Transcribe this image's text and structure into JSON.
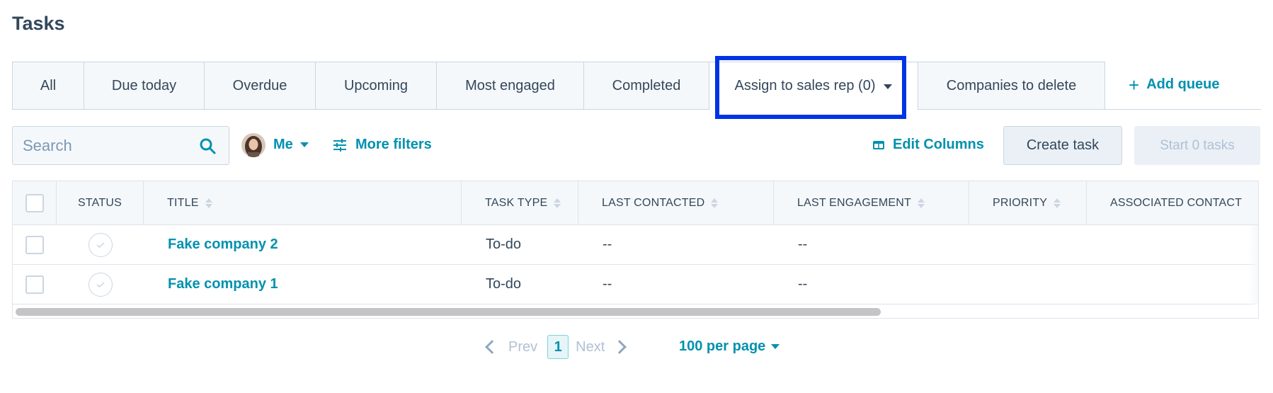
{
  "page_title": "Tasks",
  "tabs": [
    {
      "label": "All"
    },
    {
      "label": "Due today"
    },
    {
      "label": "Overdue"
    },
    {
      "label": "Upcoming"
    },
    {
      "label": "Most engaged"
    },
    {
      "label": "Completed"
    },
    {
      "label": "Assign to sales rep (0)",
      "active": true
    },
    {
      "label": "Companies to delete"
    }
  ],
  "add_queue_label": "Add queue",
  "search": {
    "placeholder": "Search",
    "value": ""
  },
  "owner_filter_label": "Me",
  "more_filters_label": "More filters",
  "edit_columns_label": "Edit Columns",
  "create_task_label": "Create task",
  "start_tasks_label": "Start 0 tasks",
  "table": {
    "headers": [
      "STATUS",
      "TITLE",
      "TASK TYPE",
      "LAST CONTACTED",
      "LAST ENGAGEMENT",
      "PRIORITY",
      "ASSOCIATED CONTACT"
    ],
    "rows": [
      {
        "title": "Fake company 2",
        "task_type": "To-do",
        "last_contacted": "--",
        "last_engagement": "--"
      },
      {
        "title": "Fake company 1",
        "task_type": "To-do",
        "last_contacted": "--",
        "last_engagement": "--"
      }
    ]
  },
  "pagination": {
    "prev_label": "Prev",
    "current_page": "1",
    "next_label": "Next",
    "per_page_label": "100 per page"
  },
  "colors": {
    "accent": "#0091ae",
    "text": "#33475b",
    "highlight_box": "#0033e6"
  }
}
